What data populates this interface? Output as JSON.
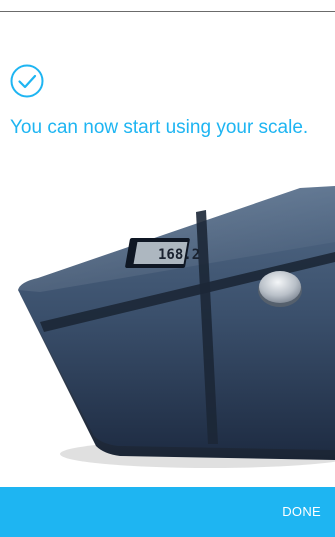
{
  "message": {
    "text": "You can now start using your scale."
  },
  "scale": {
    "display_reading": "168.2"
  },
  "footer": {
    "done_label": "DONE"
  },
  "colors": {
    "accent": "#1eb5f2",
    "scale_top": "#3f5571",
    "scale_bottom": "#22304a"
  },
  "icons": {
    "confirmation": "check-circle-icon"
  }
}
